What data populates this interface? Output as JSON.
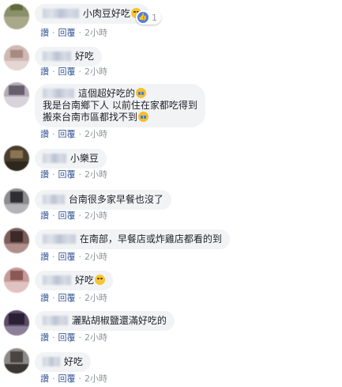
{
  "actions": {
    "like": "讚",
    "reply": "回覆",
    "sep": "·"
  },
  "colors": {
    "bubble": "#f2f3f5",
    "link": "#385898",
    "meta": "#90949c",
    "like_badge": "#4a7fe8"
  },
  "comments": [
    {
      "lines": [
        "小肉豆好吃"
      ],
      "emoji": "smile",
      "reaction_count": "1",
      "time": "2小時"
    },
    {
      "lines": [
        "好吃"
      ],
      "time": "2小時"
    },
    {
      "lines": [
        "這個超好吃的",
        "我是台南鄉下人 以前住在家都吃得到",
        "搬來台南市區都找不到"
      ],
      "line_emoji": [
        "cry",
        "",
        "cry"
      ],
      "time": "2小時"
    },
    {
      "lines": [
        "小樂豆"
      ],
      "time": "2小時"
    },
    {
      "lines": [
        "台南很多家早餐也沒了"
      ],
      "time": "2小時"
    },
    {
      "lines": [
        "在南部，早餐店或炸雞店都看的到"
      ],
      "time": "2小時"
    },
    {
      "lines": [
        "好吃"
      ],
      "emoji": "smile",
      "time": "2小時"
    },
    {
      "lines": [
        "灑點胡椒鹽還滿好吃的"
      ],
      "time": "2小時"
    },
    {
      "lines": [
        "好吃"
      ],
      "time": "2小時"
    }
  ]
}
